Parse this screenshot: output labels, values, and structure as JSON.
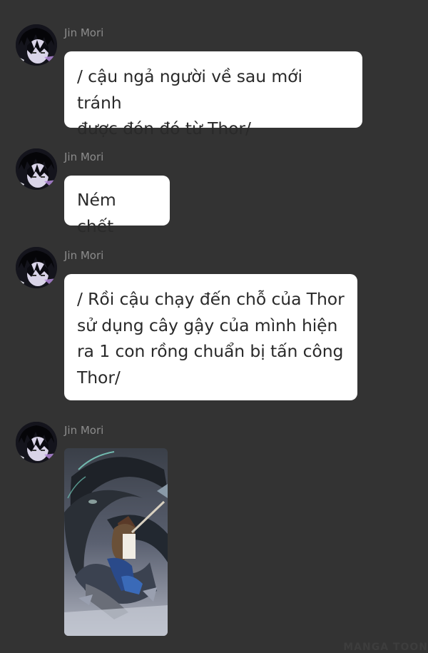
{
  "messages": [
    {
      "sender": "Jin Mori",
      "text": "/ cậu ngả người về sau mới tránh\nđược đón đó từ Thor/"
    },
    {
      "sender": "Jin Mori",
      "text": "Ném chết"
    },
    {
      "sender": "Jin Mori",
      "text": "/ Rồi cậu chạy đến chỗ của Thor\nsử dụng cây gậy của mình hiện\nra 1 con rồng chuẩn bị tấn công\nThor/"
    },
    {
      "sender": "Jin Mori",
      "image": "dragon-attack-illustration"
    }
  ],
  "watermark": "MANGA TOON",
  "colors": {
    "background": "#333333",
    "bubble": "#ffffff",
    "text": "#2a2a2a",
    "sender": "#8c8c8c"
  }
}
